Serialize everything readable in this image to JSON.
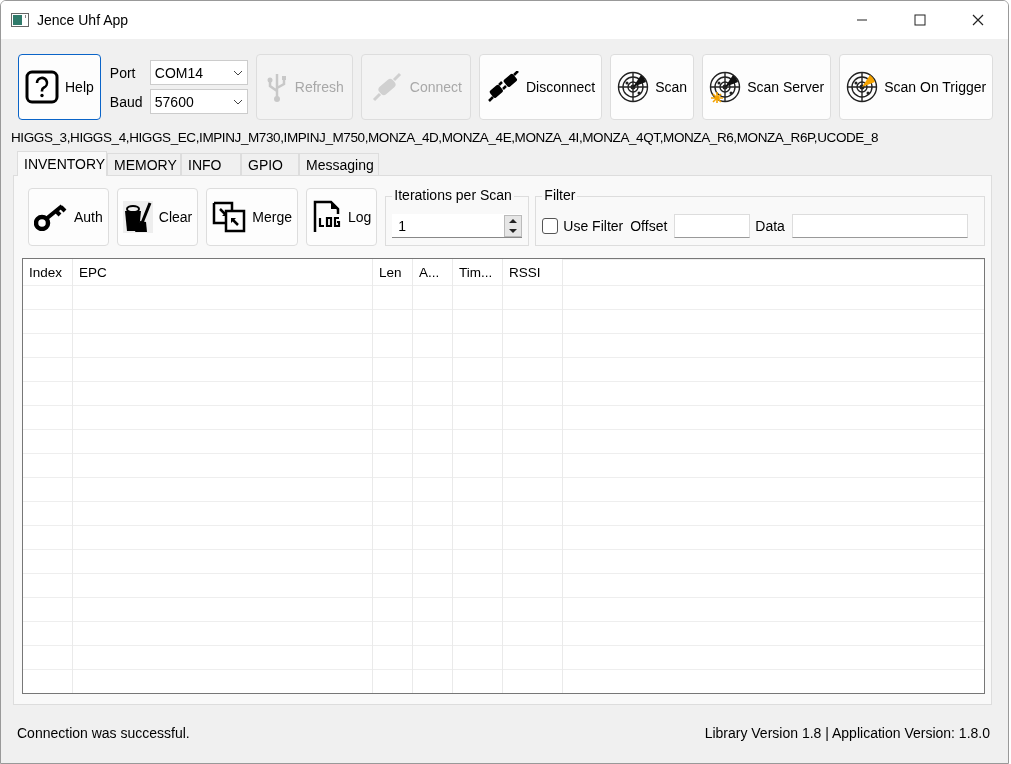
{
  "window": {
    "title": "Jence Uhf App"
  },
  "toolbar": {
    "help": {
      "label": "Help"
    },
    "port": {
      "label": "Port",
      "value": "COM14"
    },
    "baud": {
      "label": "Baud",
      "value": "57600"
    },
    "buttons": [
      {
        "label": "Refresh",
        "kind": "usb",
        "disabled": true
      },
      {
        "label": "Connect",
        "kind": "plug",
        "disabled": true
      },
      {
        "label": "Disconnect",
        "kind": "unplug",
        "disabled": false
      },
      {
        "label": "Scan",
        "kind": "radar",
        "disabled": false
      },
      {
        "label": "Scan Server",
        "kind": "radar-server",
        "disabled": false
      },
      {
        "label": "Scan On Trigger",
        "kind": "radar-trigger",
        "disabled": false
      }
    ]
  },
  "tag_types": "HIGGS_3,HIGGS_4,HIGGS_EC,IMPINJ_M730,IMPINJ_M750,MONZA_4D,MONZA_4E,MONZA_4I,MONZA_4QT,MONZA_R6,MONZA_R6P,UCODE_8",
  "tabs": [
    {
      "label": "INVENTORY",
      "selected": true
    },
    {
      "label": "MEMORY",
      "selected": false
    },
    {
      "label": "INFO",
      "selected": false
    },
    {
      "label": "GPIO",
      "selected": false
    },
    {
      "label": "Messaging",
      "selected": false
    }
  ],
  "actions": [
    {
      "label": "Auth",
      "kind": "key"
    },
    {
      "label": "Clear",
      "kind": "broom"
    },
    {
      "label": "Merge",
      "kind": "merge"
    },
    {
      "label": "Log",
      "kind": "log"
    }
  ],
  "iterations": {
    "label": "Iterations per Scan",
    "value": "1"
  },
  "filter": {
    "label": "Filter",
    "use_filter": {
      "label": "Use Filter",
      "checked": false
    },
    "offset": {
      "label": "Offset"
    },
    "data": {
      "label": "Data"
    }
  },
  "table": {
    "columns": [
      "Index",
      "EPC",
      "Len",
      "A...",
      "Tim...",
      "RSSI"
    ]
  },
  "status_bar": {
    "message": "Connection was successful.",
    "version": "Library Version 1.8 | Application Version: 1.8.0"
  }
}
